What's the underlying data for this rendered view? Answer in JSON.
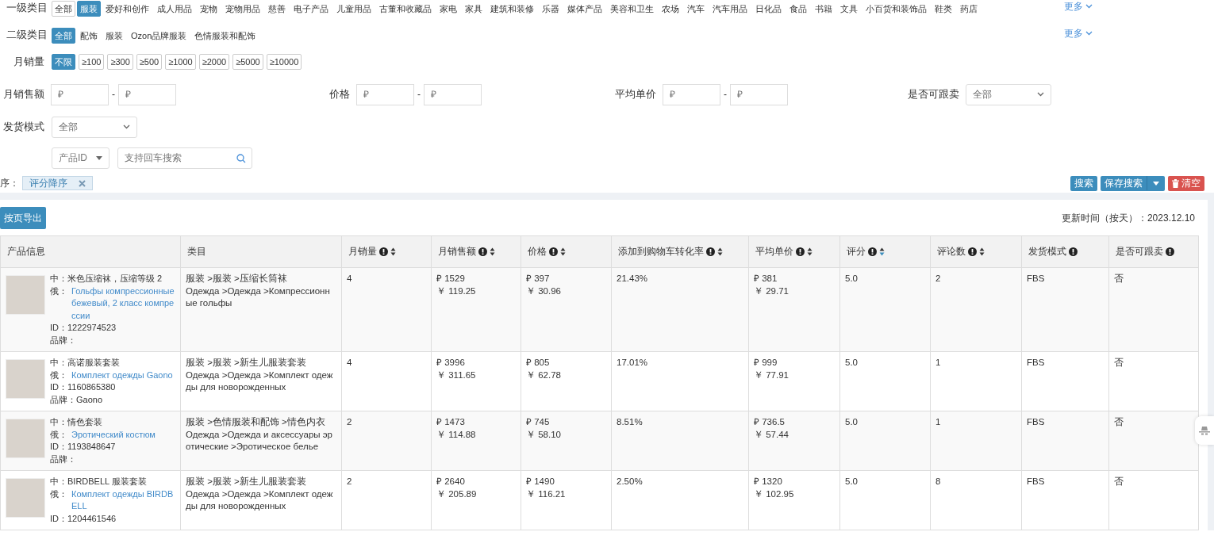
{
  "filters": [
    {
      "label": "一级类目",
      "more": "更多",
      "options": [
        {
          "label": "全部",
          "selected": false,
          "bordered": true
        },
        {
          "label": "服装",
          "selected": true,
          "bordered": false
        },
        {
          "label": "爱好和创作",
          "selected": false,
          "bordered": false
        },
        {
          "label": "成人用品",
          "selected": false,
          "bordered": false
        },
        {
          "label": "宠物",
          "selected": false,
          "bordered": false
        },
        {
          "label": "宠物用品",
          "selected": false,
          "bordered": false
        },
        {
          "label": "慈善",
          "selected": false,
          "bordered": false
        },
        {
          "label": "电子产品",
          "selected": false,
          "bordered": false
        },
        {
          "label": "儿童用品",
          "selected": false,
          "bordered": false
        },
        {
          "label": "古董和收藏品",
          "selected": false,
          "bordered": false
        },
        {
          "label": "家电",
          "selected": false,
          "bordered": false
        },
        {
          "label": "家具",
          "selected": false,
          "bordered": false
        },
        {
          "label": "建筑和装修",
          "selected": false,
          "bordered": false
        },
        {
          "label": "乐器",
          "selected": false,
          "bordered": false
        },
        {
          "label": "媒体产品",
          "selected": false,
          "bordered": false
        },
        {
          "label": "美容和卫生",
          "selected": false,
          "bordered": false
        },
        {
          "label": "农场",
          "selected": false,
          "bordered": false
        },
        {
          "label": "汽车",
          "selected": false,
          "bordered": false
        },
        {
          "label": "汽车用品",
          "selected": false,
          "bordered": false
        },
        {
          "label": "日化品",
          "selected": false,
          "bordered": false
        },
        {
          "label": "食品",
          "selected": false,
          "bordered": false
        },
        {
          "label": "书籍",
          "selected": false,
          "bordered": false
        },
        {
          "label": "文具",
          "selected": false,
          "bordered": false
        },
        {
          "label": "小百货和装饰品",
          "selected": false,
          "bordered": false
        },
        {
          "label": "鞋类",
          "selected": false,
          "bordered": false
        },
        {
          "label": "药店",
          "selected": false,
          "bordered": false
        }
      ]
    },
    {
      "label": "二级类目",
      "more": "更多",
      "options": [
        {
          "label": "全部",
          "selected": true,
          "bordered": false
        },
        {
          "label": "配饰",
          "selected": false,
          "bordered": false
        },
        {
          "label": "服装",
          "selected": false,
          "bordered": false
        },
        {
          "label": "Ozon品牌服装",
          "selected": false,
          "bordered": false
        },
        {
          "label": "色情服装和配饰",
          "selected": false,
          "bordered": false
        }
      ]
    },
    {
      "label": "月销量",
      "options": [
        {
          "label": "不限",
          "selected": true,
          "bordered": false
        },
        {
          "label": "≥100",
          "selected": false,
          "bordered": true
        },
        {
          "label": "≥300",
          "selected": false,
          "bordered": true
        },
        {
          "label": "≥500",
          "selected": false,
          "bordered": true
        },
        {
          "label": "≥1000",
          "selected": false,
          "bordered": true
        },
        {
          "label": "≥2000",
          "selected": false,
          "bordered": true
        },
        {
          "label": "≥5000",
          "selected": false,
          "bordered": true
        },
        {
          "label": "≥10000",
          "selected": false,
          "bordered": true
        }
      ]
    }
  ],
  "ranges": [
    {
      "label": "月销售额",
      "from_placeholder": "₽",
      "to_placeholder": "₽",
      "separator": "-"
    },
    {
      "label": "价格",
      "from_placeholder": "₽",
      "to_placeholder": "₽",
      "separator": "-"
    },
    {
      "label": "平均单价",
      "from_placeholder": "₽",
      "to_placeholder": "₽",
      "separator": "-"
    }
  ],
  "follow_sell": {
    "label": "是否可跟卖",
    "value": "全部"
  },
  "shipping": {
    "label": "发货模式",
    "value": "全部"
  },
  "search": {
    "field_type": "产品ID",
    "placeholder": "支持回车搜索"
  },
  "sort": {
    "label": "序：",
    "tag": "评分降序"
  },
  "actions": {
    "search": "搜索",
    "save": "保存搜索",
    "clear": "清空"
  },
  "export_button": "按页导出",
  "update_time": "更新时间（按天）：2023.12.10",
  "table": {
    "columns": [
      {
        "label": "产品信息",
        "info": false,
        "sortable": false
      },
      {
        "label": "类目",
        "info": false,
        "sortable": false
      },
      {
        "label": "月销量",
        "info": true,
        "sortable": true,
        "sorted_desc": false
      },
      {
        "label": "月销售额",
        "info": true,
        "sortable": true,
        "sorted_desc": false
      },
      {
        "label": "价格",
        "info": true,
        "sortable": true,
        "sorted_desc": false
      },
      {
        "label": "添加到购物车转化率",
        "info": true,
        "sortable": true,
        "sorted_desc": false
      },
      {
        "label": "平均单价",
        "info": true,
        "sortable": true,
        "sorted_desc": false
      },
      {
        "label": "评分",
        "info": true,
        "sortable": true,
        "sorted_desc": true
      },
      {
        "label": "评论数",
        "info": true,
        "sortable": true,
        "sorted_desc": false
      },
      {
        "label": "发货模式",
        "info": true,
        "sortable": false
      },
      {
        "label": "是否可跟卖",
        "info": true,
        "sortable": false
      }
    ],
    "rows": [
      {
        "name_cn": "中：米色压缩袜，压缩等级 2",
        "name_ru_label": "俄：",
        "name_ru": "Гольфы компрессионные бежевый, 2 класс компрессии",
        "id": "ID：1222974523",
        "brand": "品牌：",
        "category_cn": "服装 >服装 >压缩长筒袜",
        "category_ru": "Одежда >Одежда >Компрессионные гольфы",
        "sales": "4",
        "revenue_rub": "₽ 1529",
        "revenue_cny": "￥ 119.25",
        "price_rub": "₽ 397",
        "price_cny": "￥ 30.96",
        "conversion": "21.43%",
        "avg_rub": "₽ 381",
        "avg_cny": "￥ 29.71",
        "rating": "5.0",
        "reviews": "2",
        "shipping": "FBS",
        "follow": "否"
      },
      {
        "name_cn": "中：高诺服装套装",
        "name_ru_label": "俄：",
        "name_ru": "Комплект одежды Gaono",
        "id": "ID：1160865380",
        "brand": "品牌：Gaono",
        "category_cn": "服装 >服装 >新生儿服装套装",
        "category_ru": "Одежда >Одежда >Комплект одежды для новорожденных",
        "sales": "4",
        "revenue_rub": "₽ 3996",
        "revenue_cny": "￥ 311.65",
        "price_rub": "₽ 805",
        "price_cny": "￥ 62.78",
        "conversion": "17.01%",
        "avg_rub": "₽ 999",
        "avg_cny": "￥ 77.91",
        "rating": "5.0",
        "reviews": "1",
        "shipping": "FBS",
        "follow": "否"
      },
      {
        "name_cn": "中：情色套装",
        "name_ru_label": "俄：",
        "name_ru": "Эротический костюм",
        "id": "ID：1193848647",
        "brand": "品牌：",
        "category_cn": "服装 >色情服装和配饰 >情色内衣",
        "category_ru": "Одежда >Одежда и аксессуары эротические >Эротическое белье",
        "sales": "2",
        "revenue_rub": "₽ 1473",
        "revenue_cny": "￥ 114.88",
        "price_rub": "₽ 745",
        "price_cny": "￥ 58.10",
        "conversion": "8.51%",
        "avg_rub": "₽ 736.5",
        "avg_cny": "￥ 57.44",
        "rating": "5.0",
        "reviews": "1",
        "shipping": "FBS",
        "follow": "否"
      },
      {
        "name_cn": "中：BIRDBELL 服装套装",
        "name_ru_label": "俄：",
        "name_ru": "Комплект одежды BIRDBELL",
        "id": "ID：1204461546",
        "category_cn": "服装 >服装 >新生儿服装套装",
        "category_ru": "Одежда >Одежда >Комплект одежды для новорожденных",
        "sales": "2",
        "revenue_rub": "₽ 2640",
        "revenue_cny": "￥ 205.89",
        "price_rub": "₽ 1490",
        "price_cny": "￥ 116.21",
        "conversion": "2.50%",
        "avg_rub": "₽ 1320",
        "avg_cny": "￥ 102.95",
        "rating": "5.0",
        "reviews": "8",
        "shipping": "FBS",
        "follow": "否"
      }
    ]
  }
}
